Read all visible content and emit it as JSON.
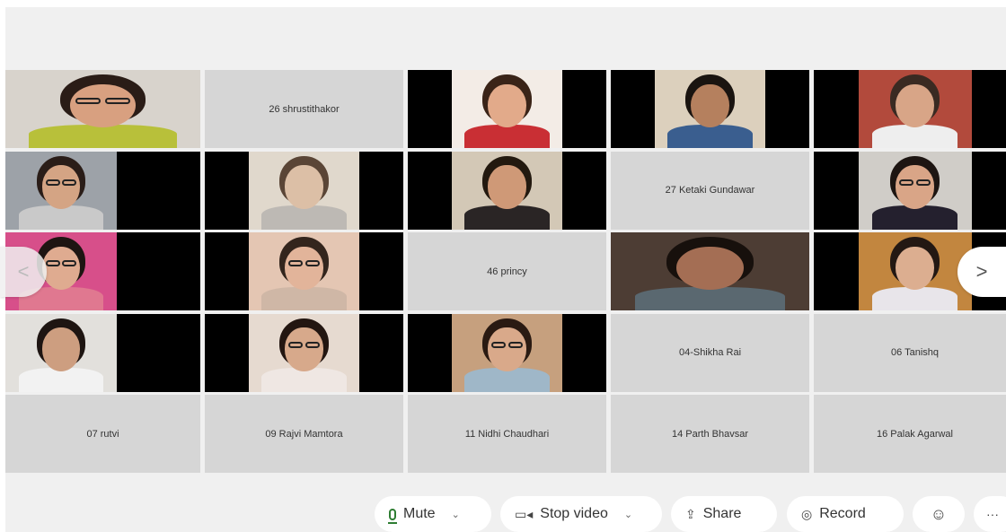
{
  "participants": [
    {
      "kind": "video",
      "layout": "full",
      "wall": "#d8d3cc",
      "skin": "#d8a080",
      "hair": "#2a1c16",
      "shirt": "#b8c03a",
      "glasses": true
    },
    {
      "kind": "name",
      "label": "26 shrustithakor"
    },
    {
      "kind": "video",
      "layout": "center",
      "wall": "#f3ece6",
      "skin": "#e2aa8a",
      "hair": "#3a2418",
      "shirt": "#c92f34",
      "glasses": false
    },
    {
      "kind": "video",
      "layout": "center",
      "wall": "#dcd0bd",
      "skin": "#b5805e",
      "hair": "#1a1410",
      "shirt": "#3a5e8f",
      "glasses": false
    },
    {
      "kind": "video",
      "layout": "center",
      "wall": "#b24a3c",
      "skin": "#d8a587",
      "hair": "#3a2a22",
      "shirt": "#eeeeee",
      "glasses": false
    },
    {
      "kind": "video",
      "layout": "left",
      "wall": "#9da2a8",
      "skin": "#d4a484",
      "hair": "#2a1d18",
      "shirt": "#c9c9c9",
      "glasses": true
    },
    {
      "kind": "video",
      "layout": "center",
      "wall": "#e0d8cc",
      "skin": "#dcbfa6",
      "hair": "#5a4536",
      "shirt": "#bdb9b4",
      "glasses": false
    },
    {
      "kind": "video",
      "layout": "center",
      "wall": "#d3c8b6",
      "skin": "#cf9977",
      "hair": "#23190f",
      "shirt": "#2a2525",
      "glasses": false
    },
    {
      "kind": "name",
      "label": "27 Ketaki Gundawar"
    },
    {
      "kind": "video",
      "layout": "center",
      "wall": "#d0cdc8",
      "skin": "#d9a587",
      "hair": "#1d1512",
      "shirt": "#24202e",
      "glasses": true
    },
    {
      "kind": "video",
      "layout": "left",
      "wall": "#d74f8a",
      "skin": "#dfab90",
      "hair": "#1e1512",
      "shirt": "#e07890",
      "glasses": true
    },
    {
      "kind": "video",
      "layout": "center",
      "wall": "#e4c6b3",
      "skin": "#e2b49a",
      "hair": "#33251d",
      "shirt": "#cfb7a6",
      "glasses": true
    },
    {
      "kind": "name",
      "label": "46 princy"
    },
    {
      "kind": "video",
      "layout": "full",
      "wall": "#4d3d34",
      "skin": "#a46e54",
      "hair": "#17100c",
      "shirt": "#5a6870",
      "glasses": false
    },
    {
      "kind": "video",
      "layout": "center",
      "wall": "#c2863f",
      "skin": "#dcae90",
      "hair": "#231813",
      "shirt": "#e8e5ea",
      "glasses": false
    },
    {
      "kind": "video",
      "layout": "left",
      "wall": "#e2e0dc",
      "skin": "#cd9e80",
      "hair": "#1e1512",
      "shirt": "#f2f2f2",
      "glasses": false
    },
    {
      "kind": "video",
      "layout": "center",
      "wall": "#e6dad0",
      "skin": "#d7a98b",
      "hair": "#231611",
      "shirt": "#efe7e3",
      "glasses": true
    },
    {
      "kind": "video",
      "layout": "center",
      "wall": "#c6a07e",
      "skin": "#d9a98a",
      "hair": "#2a1a12",
      "shirt": "#9fb7c8",
      "glasses": true
    },
    {
      "kind": "name",
      "label": "04-Shikha Rai"
    },
    {
      "kind": "name",
      "label": "06 Tanishq"
    },
    {
      "kind": "name",
      "label": "07 rutvi"
    },
    {
      "kind": "name",
      "label": "09 Rajvi Mamtora"
    },
    {
      "kind": "name",
      "label": "11 Nidhi Chaudhari"
    },
    {
      "kind": "name",
      "label": "14 Parth Bhavsar"
    },
    {
      "kind": "name",
      "label": "16 Palak Agarwal"
    }
  ],
  "nav": {
    "prev_icon": "chevron-left",
    "next_icon": "chevron-right",
    "prev_glyph": "<",
    "next_glyph": ">"
  },
  "toolbar": {
    "mute_label": "Mute",
    "stop_video_label": "Stop video",
    "share_label": "Share",
    "record_label": "Record",
    "more_glyph": "···",
    "chevron_glyph": "⌄",
    "video_glyph": "▭◂",
    "share_glyph": "⇪",
    "record_glyph": "◎",
    "reactions_glyph": "☺",
    "mic_color": "#2e7d32"
  }
}
